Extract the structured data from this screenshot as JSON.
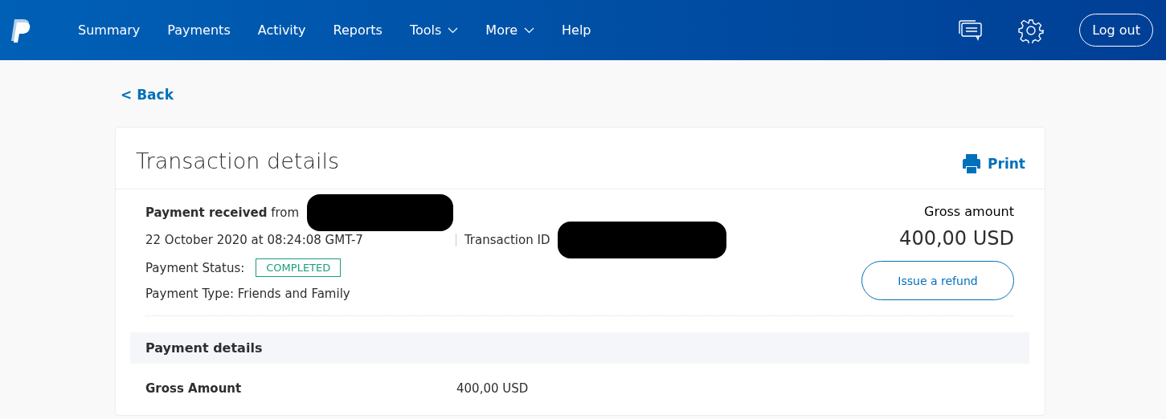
{
  "nav": {
    "items": [
      {
        "label": "Summary",
        "dropdown": false
      },
      {
        "label": "Payments",
        "dropdown": false
      },
      {
        "label": "Activity",
        "dropdown": false
      },
      {
        "label": "Reports",
        "dropdown": false
      },
      {
        "label": "Tools",
        "dropdown": true
      },
      {
        "label": "More",
        "dropdown": true
      },
      {
        "label": "Help",
        "dropdown": false
      }
    ],
    "logout": "Log out"
  },
  "back": "< Back",
  "card": {
    "title": "Transaction details",
    "print": "Print",
    "received": "**Payment received** from",
    "date": "22 October 2020 at 08:24:08 GMT-7",
    "transaction_id_label": "Transaction ID",
    "status_label": "Payment Status:",
    "status": "COMPLETED",
    "type": "Payment Type: Friends and Family",
    "gross_label": "Gross amount",
    "gross": "400,00 USD",
    "refund": "Issue a refund",
    "section": "Payment details",
    "rows": [
      {
        "label": "Gross Amount",
        "value": "400,00 USD"
      }
    ]
  }
}
